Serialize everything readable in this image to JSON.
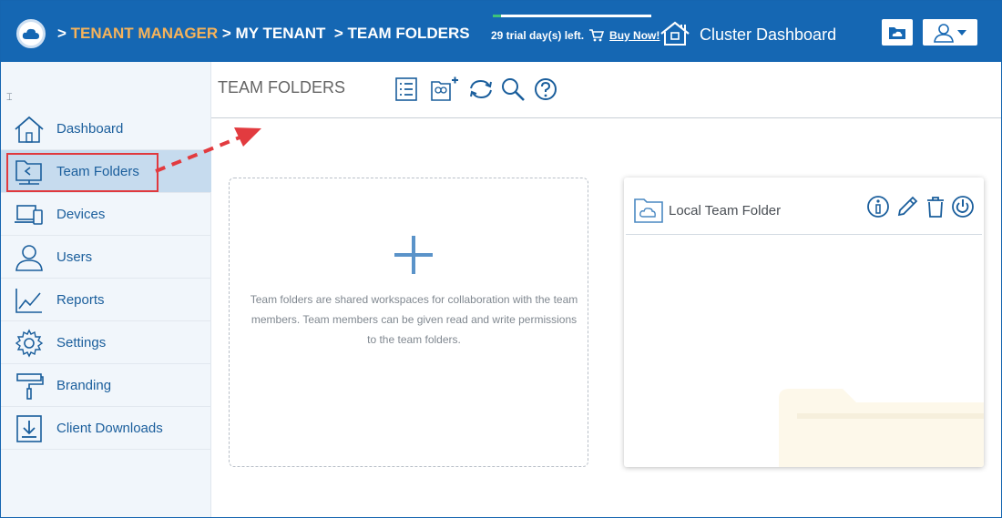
{
  "header": {
    "breadcrumb_prefix": ">",
    "breadcrumb": [
      ">",
      "TENANT MANAGER",
      "> MY TENANT",
      "> TEAM FOLDERS"
    ],
    "trial_text": "29 trial day(s) left.",
    "trial_progress": 0.05,
    "buy_label": "Buy Now!",
    "cluster_label": "Cluster Dashboard",
    "colors": {
      "bar": "#1567b3",
      "active_crumb": "#f6b35a"
    }
  },
  "sidebar": {
    "collapse_glyph": "⌶",
    "items": [
      {
        "label": "Dashboard",
        "icon": "home-icon"
      },
      {
        "label": "Team Folders",
        "icon": "shared-folder-icon",
        "active": true
      },
      {
        "label": "Devices",
        "icon": "devices-icon"
      },
      {
        "label": "Users",
        "icon": "user-icon"
      },
      {
        "label": "Reports",
        "icon": "chart-icon"
      },
      {
        "label": "Settings",
        "icon": "gear-icon"
      },
      {
        "label": "Branding",
        "icon": "paint-roller-icon"
      },
      {
        "label": "Client Downloads",
        "icon": "download-icon"
      }
    ]
  },
  "toolbar": {
    "title": "TEAM FOLDERS",
    "icons": [
      "list-view-icon",
      "add-team-folder-icon",
      "refresh-icon",
      "search-icon",
      "help-icon"
    ]
  },
  "new_card": {
    "description": "Team folders are shared workspaces for collaboration with the team members. Team members can be given read and write permissions to the team folders."
  },
  "team_folders": [
    {
      "name": "Local Team Folder",
      "actions": [
        "info-icon",
        "edit-icon",
        "delete-icon",
        "power-icon"
      ]
    }
  ]
}
